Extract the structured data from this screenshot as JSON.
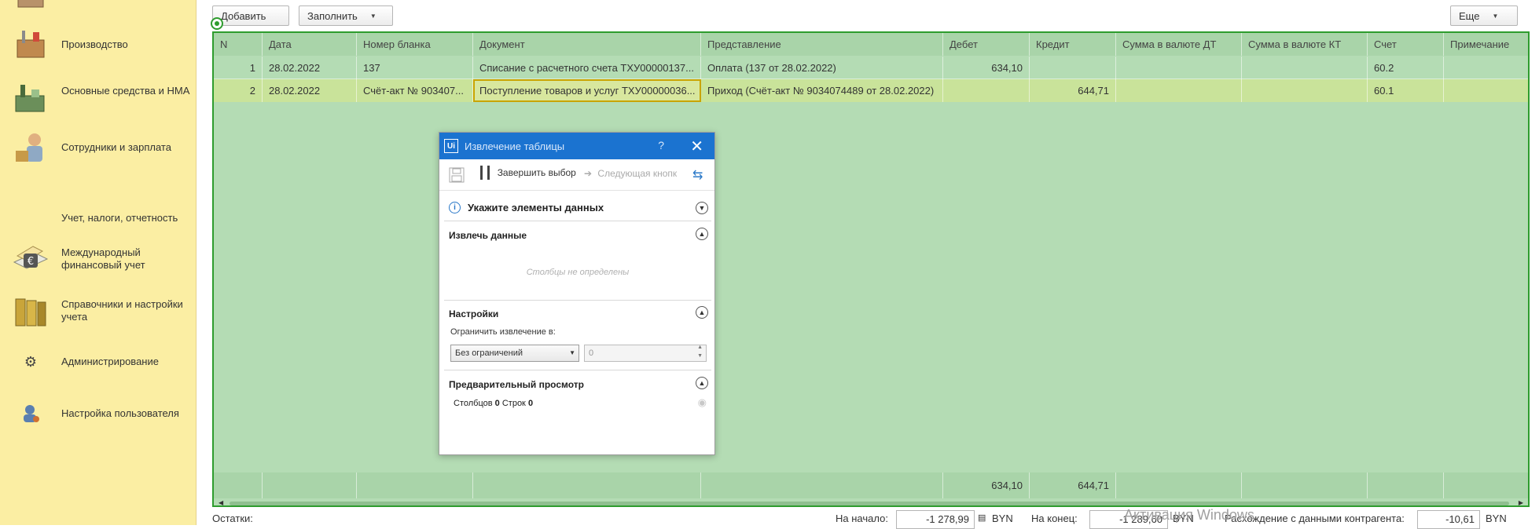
{
  "sidebar": {
    "items": [
      {
        "label": "Производство",
        "icon": "tools-box-icon"
      },
      {
        "label": "Основные средства и НМА",
        "icon": "factory-icon"
      },
      {
        "label": "Сотрудники и зарплата",
        "icon": "employees-icon"
      },
      {
        "label": "Учет, налоги, отчетность",
        "icon": "reports-icon"
      },
      {
        "label": "Международный финансовый учет",
        "icon": "euro-icon"
      },
      {
        "label": "Справочники и настройки учета",
        "icon": "binders-icon"
      },
      {
        "label": "Администрирование",
        "icon": "gear-icon"
      },
      {
        "label": "Настройка пользователя",
        "icon": "user-settings-icon"
      }
    ]
  },
  "toolbar": {
    "add_label": "Добавить",
    "fill_label": "Заполнить",
    "more_label": "Еще"
  },
  "table": {
    "columns": [
      "N",
      "Дата",
      "Номер бланка",
      "Документ",
      "Представление",
      "Дебет",
      "Кредит",
      "Сумма в валюте ДТ",
      "Сумма в валюте КТ",
      "Счет",
      "Примечание"
    ],
    "rows": [
      {
        "n": "1",
        "date": "28.02.2022",
        "blank": "137",
        "doc": "Списание с расчетного счета ТХУ00000137...",
        "repr": "Оплата (137 от 28.02.2022)",
        "debit": "634,10",
        "credit": "",
        "sum_dt": "",
        "sum_kt": "",
        "account": "60.2",
        "note": ""
      },
      {
        "n": "2",
        "date": "28.02.2022",
        "blank": "Счёт-акт № 903407...",
        "doc": "Поступление товаров и услуг ТХУ00000036...",
        "repr": "Приход (Счёт-акт № 9034074489 от 28.02.2022)",
        "debit": "",
        "credit": "644,71",
        "sum_dt": "",
        "sum_kt": "",
        "account": "60.1",
        "note": ""
      }
    ],
    "totals": {
      "debit": "634,10",
      "credit": "644,71"
    }
  },
  "bottom": {
    "balances_label": "Остатки:",
    "start_label": "На начало:",
    "start_value": "-1 278,99",
    "currency1": "BYN",
    "end_label": "На конец:",
    "end_value": "-1 289,60",
    "currency2": "BYN",
    "diff_label": "Расхождение с данными контрагента:",
    "diff_value": "-10,61",
    "currency3": "BYN"
  },
  "watermark": "Активация Windows",
  "dialog": {
    "logo": "Ui",
    "title": "Извлечение таблицы",
    "help": "?",
    "close": "✕",
    "finish_label": "Завершить выбор",
    "next_label": "Следующая кнопк",
    "specify_label": "Укажите элементы данных",
    "extract_header": "Извлечь данные",
    "no_columns": "Столбцы не определены",
    "settings_header": "Настройки",
    "limit_label": "Ограничить извлечение в:",
    "limit_select": "Без ограничений",
    "limit_value": "0",
    "preview_header": "Предварительный просмотр",
    "columns_label": "Столбцов",
    "columns_count": "0",
    "rows_label": "Строк",
    "rows_count": "0"
  },
  "colors": {
    "sidebar_bg": "#fbeea3",
    "selection_green": "#b4dcb4",
    "selection_border": "#2e9c2e",
    "dialog_title": "#1b73d0"
  }
}
